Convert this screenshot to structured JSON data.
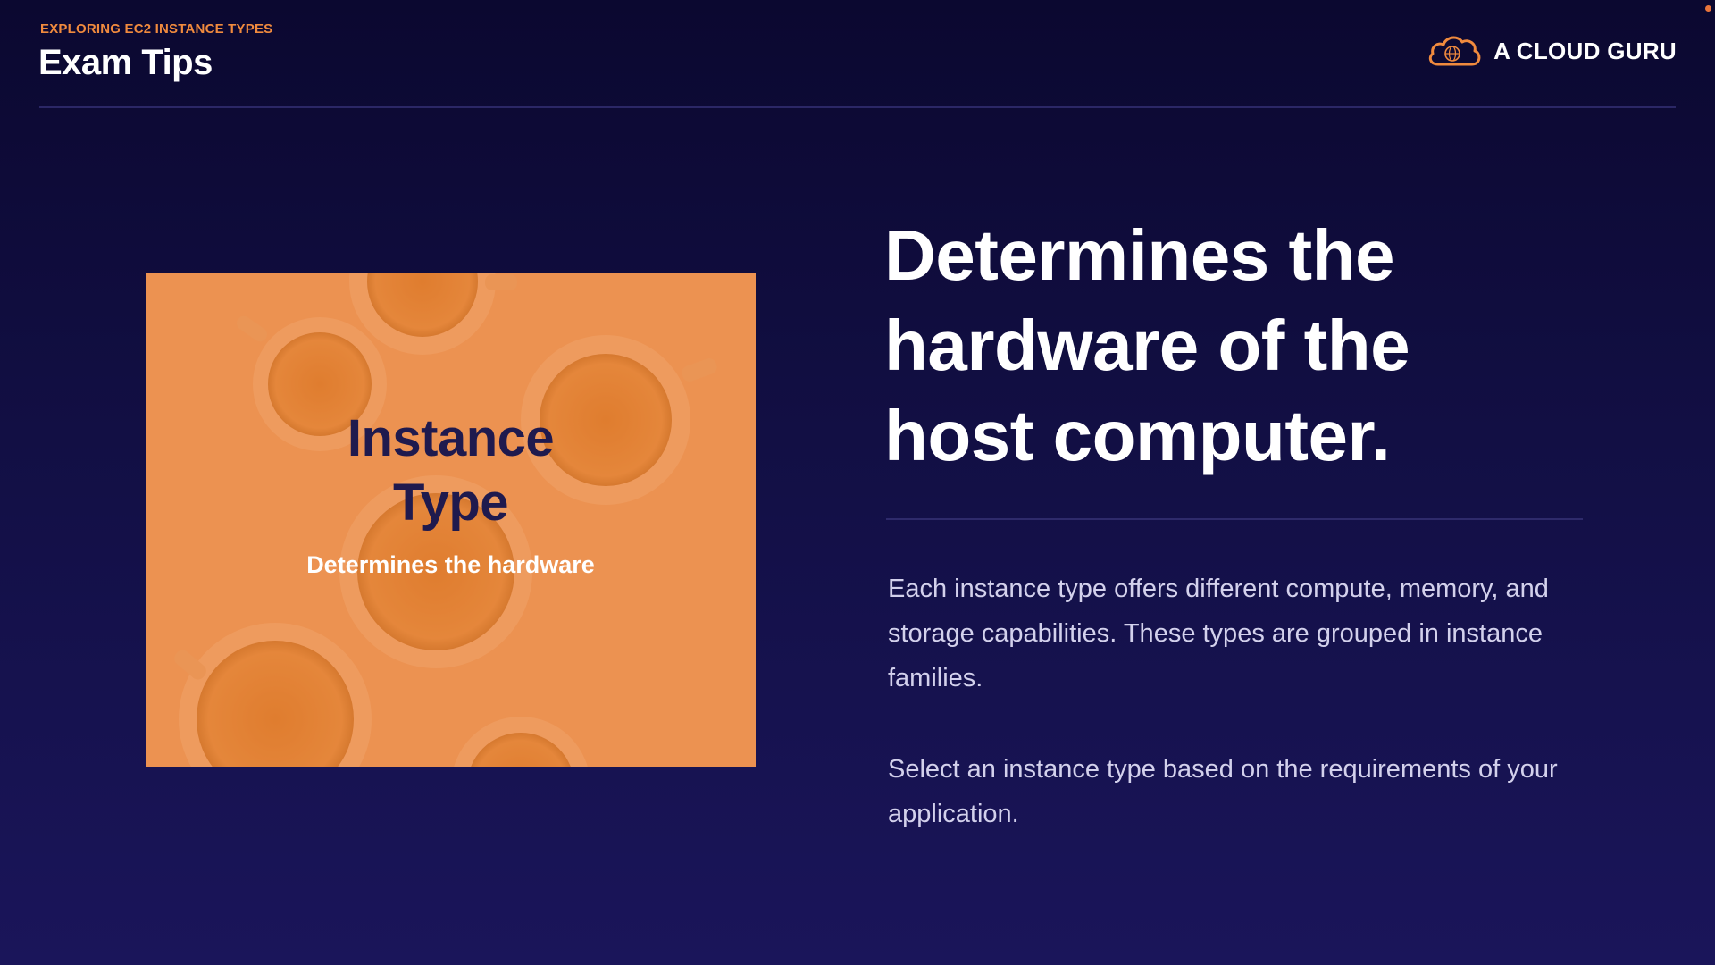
{
  "header": {
    "eyebrow": "EXPLORING EC2 INSTANCE TYPES",
    "title": "Exam Tips"
  },
  "brand": {
    "name": "A CLOUD GURU",
    "logo_icon": "cloud-logo-icon",
    "accent_color": "#f08a3e"
  },
  "card": {
    "title_line1": "Instance",
    "title_line2": "Type",
    "subtitle": "Determines the hardware",
    "background_color": "#ec9150",
    "image": "teacups-top-view"
  },
  "main": {
    "headline_line1": "Determines the",
    "headline_line2": "hardware of the",
    "headline_line3": "host computer.",
    "paragraph1": "Each instance type offers different compute, memory, and storage capabilities. These types are grouped in instance families.",
    "paragraph2": "Select an instance type based on the requirements of your application."
  },
  "colors": {
    "background_top": "#0b0830",
    "background_bottom": "#1a155a",
    "card_title": "#1f1a4e",
    "body_text": "#d3d1ec"
  }
}
